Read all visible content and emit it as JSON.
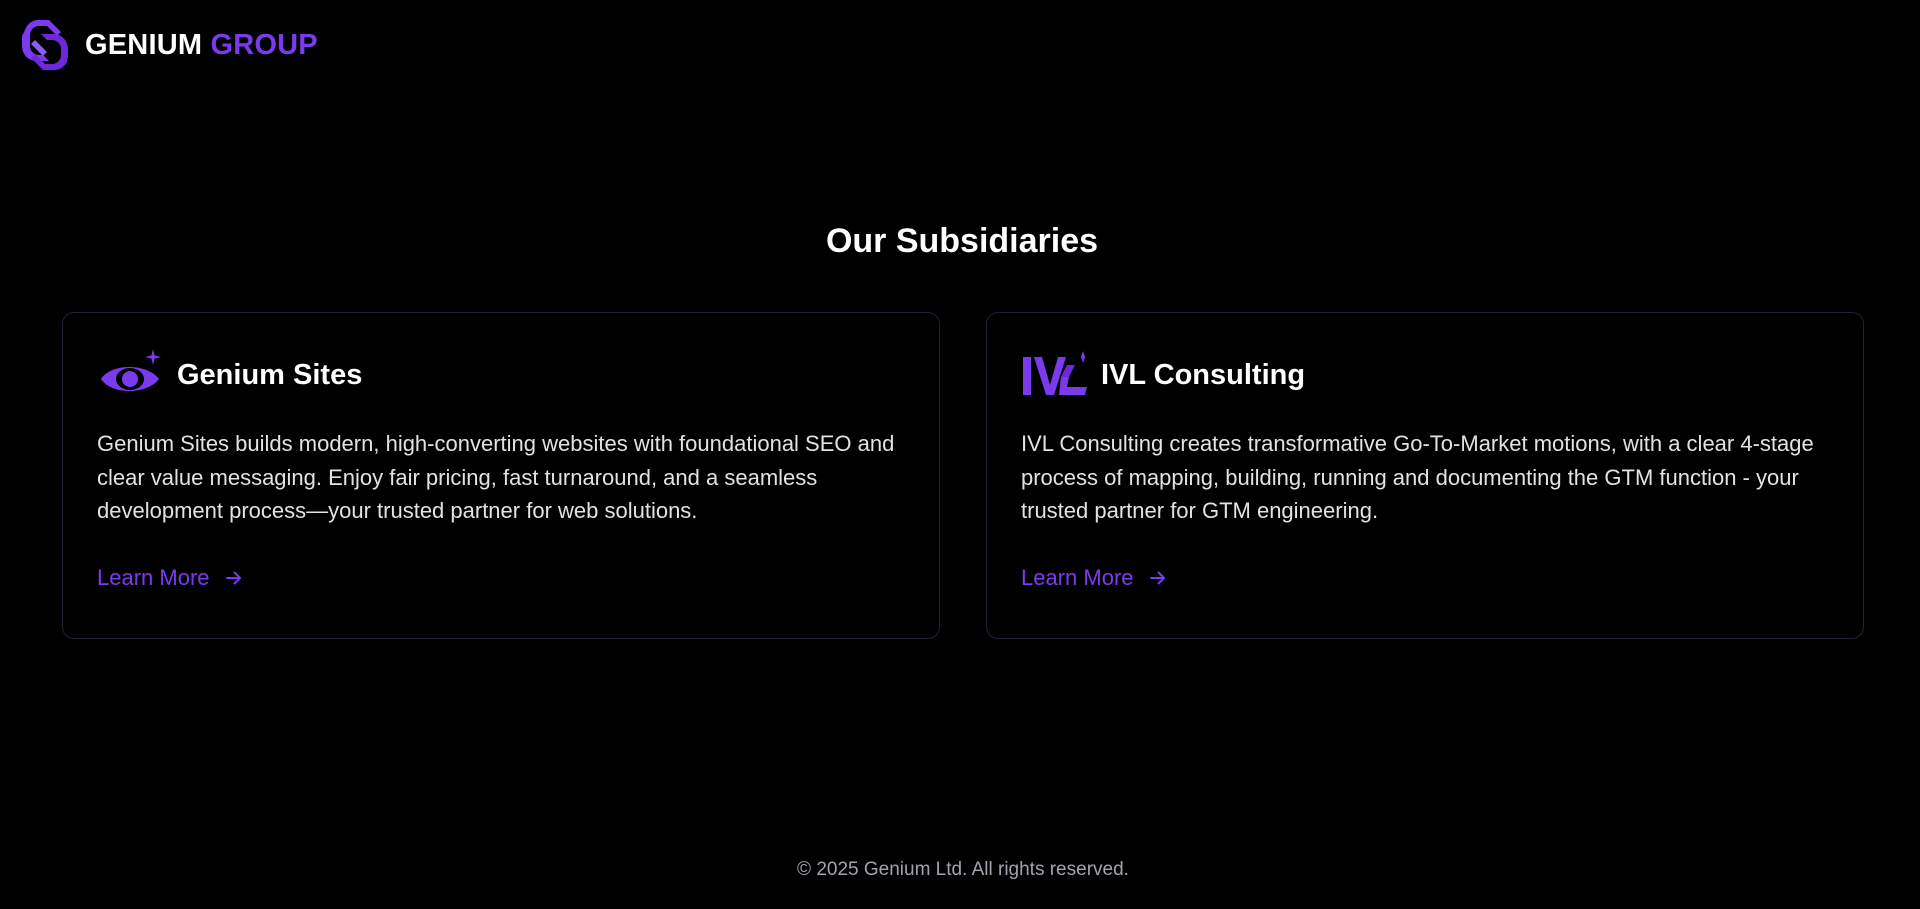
{
  "header": {
    "brand_first": "GENIUM",
    "brand_second": "GROUP",
    "logo_icon": "genium-group-logo",
    "accent_color": "#7c3aed"
  },
  "main": {
    "section_title": "Our Subsidiaries",
    "cards": [
      {
        "icon": "eye-sparkle-icon",
        "title": "Genium Sites",
        "description": "Genium Sites builds modern, high-converting websites with foundational SEO and clear value messaging. Enjoy fair pricing, fast turnaround, and a seamless development process—your trusted partner for web solutions.",
        "link_label": "Learn More"
      },
      {
        "icon": "ivl-logo-icon",
        "title": "IVL Consulting",
        "description": "IVL Consulting creates transformative Go-To-Market motions, with a clear 4-stage process of mapping, building, running and documenting the GTM function - your trusted partner for GTM engineering.",
        "link_label": "Learn More"
      }
    ]
  },
  "footer": {
    "copyright": "© 2025 Genium Ltd. All rights reserved."
  },
  "colors": {
    "background": "#000000",
    "accent": "#7c3aed",
    "card_border": "#22223a",
    "body_text": "#e2e2e6",
    "muted_text": "#a3a3b0"
  }
}
